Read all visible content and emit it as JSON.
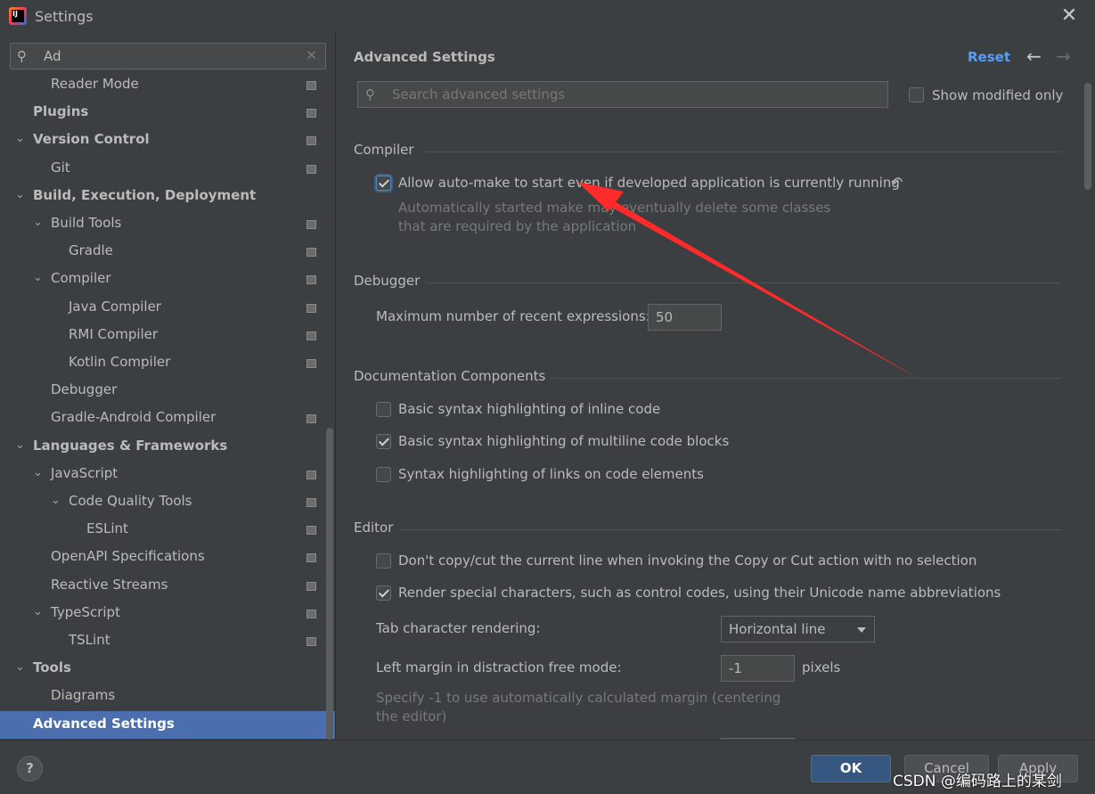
{
  "window": {
    "title": "Settings",
    "close_icon": "close-icon",
    "app_icon_text": "IJ"
  },
  "sidebar": {
    "search_value": "Ad",
    "items": [
      {
        "label": "Reader Mode",
        "level": 2,
        "bold": false,
        "toggle": "",
        "page_icon": true
      },
      {
        "label": "Plugins",
        "level": 1,
        "bold": true,
        "toggle": "",
        "page_icon": true
      },
      {
        "label": "Version Control",
        "level": 1,
        "bold": true,
        "toggle": "⌄",
        "page_icon": true
      },
      {
        "label": "Git",
        "level": 2,
        "bold": false,
        "toggle": "",
        "page_icon": true
      },
      {
        "label": "Build, Execution, Deployment",
        "level": 1,
        "bold": true,
        "toggle": "⌄",
        "page_icon": false
      },
      {
        "label": "Build Tools",
        "level": 2,
        "bold": false,
        "toggle": "⌄",
        "page_icon": true
      },
      {
        "label": "Gradle",
        "level": 3,
        "bold": false,
        "toggle": "",
        "page_icon": true
      },
      {
        "label": "Compiler",
        "level": 2,
        "bold": false,
        "toggle": "⌄",
        "page_icon": true
      },
      {
        "label": "Java Compiler",
        "level": 3,
        "bold": false,
        "toggle": "",
        "page_icon": true
      },
      {
        "label": "RMI Compiler",
        "level": 3,
        "bold": false,
        "toggle": "",
        "page_icon": true
      },
      {
        "label": "Kotlin Compiler",
        "level": 3,
        "bold": false,
        "toggle": "",
        "page_icon": true
      },
      {
        "label": "Debugger",
        "level": 2,
        "bold": false,
        "toggle": "",
        "page_icon": false
      },
      {
        "label": "Gradle-Android Compiler",
        "level": 2,
        "bold": false,
        "toggle": "",
        "page_icon": true
      },
      {
        "label": "Languages & Frameworks",
        "level": 1,
        "bold": true,
        "toggle": "⌄",
        "page_icon": false
      },
      {
        "label": "JavaScript",
        "level": 2,
        "bold": false,
        "toggle": "⌄",
        "page_icon": true
      },
      {
        "label": "Code Quality Tools",
        "level": 3,
        "bold": false,
        "toggle": "⌄",
        "page_icon": true
      },
      {
        "label": "ESLint",
        "level": 4,
        "bold": false,
        "toggle": "",
        "page_icon": true
      },
      {
        "label": "OpenAPI Specifications",
        "level": 2,
        "bold": false,
        "toggle": "",
        "page_icon": true
      },
      {
        "label": "Reactive Streams",
        "level": 2,
        "bold": false,
        "toggle": "",
        "page_icon": true
      },
      {
        "label": "TypeScript",
        "level": 2,
        "bold": false,
        "toggle": "⌄",
        "page_icon": true
      },
      {
        "label": "TSLint",
        "level": 3,
        "bold": false,
        "toggle": "",
        "page_icon": true
      },
      {
        "label": "Tools",
        "level": 1,
        "bold": true,
        "toggle": "⌄",
        "page_icon": false
      },
      {
        "label": "Diagrams",
        "level": 2,
        "bold": false,
        "toggle": "",
        "page_icon": false
      },
      {
        "label": "Advanced Settings",
        "level": 1,
        "bold": true,
        "toggle": "",
        "page_icon": false,
        "selected": true
      }
    ]
  },
  "main": {
    "title": "Advanced Settings",
    "reset_label": "Reset",
    "search_placeholder": "Search advanced settings",
    "show_modified_label": "Show modified only",
    "compiler": {
      "header": "Compiler",
      "auto_make_label": "Allow auto-make to start even if developed application is currently running",
      "auto_make_hint": "Automatically started make may eventually delete some classes that are required by the application"
    },
    "debugger": {
      "header": "Debugger",
      "max_expr_label": "Maximum number of recent expressions:",
      "max_expr_value": "50"
    },
    "docs": {
      "header": "Documentation Components",
      "inline_label": "Basic syntax highlighting of inline code",
      "multiline_label": "Basic syntax highlighting of multiline code blocks",
      "links_label": "Syntax highlighting of links on code elements"
    },
    "editor": {
      "header": "Editor",
      "no_copy_label": "Don't copy/cut the current line when invoking the Copy or Cut action with no selection",
      "render_special_label": "Render special characters, such as control codes, using their Unicode name abbreviations",
      "tab_render_label": "Tab character rendering:",
      "tab_render_value": "Horizontal line",
      "left_margin_label": "Left margin in distraction free mode:",
      "left_margin_value": "-1",
      "left_margin_unit": "pixels",
      "left_margin_hint": "Specify -1 to use automatically calculated margin (centering the editor)"
    }
  },
  "footer": {
    "help_label": "?",
    "ok_label": "OK",
    "cancel_label": "Cancel",
    "apply_label": "Apply"
  },
  "watermark": "CSDN @编码路上的某剑",
  "colors": {
    "accent": "#4b6eaf",
    "link": "#589df6",
    "annotation_arrow": "#ff2a2a"
  }
}
